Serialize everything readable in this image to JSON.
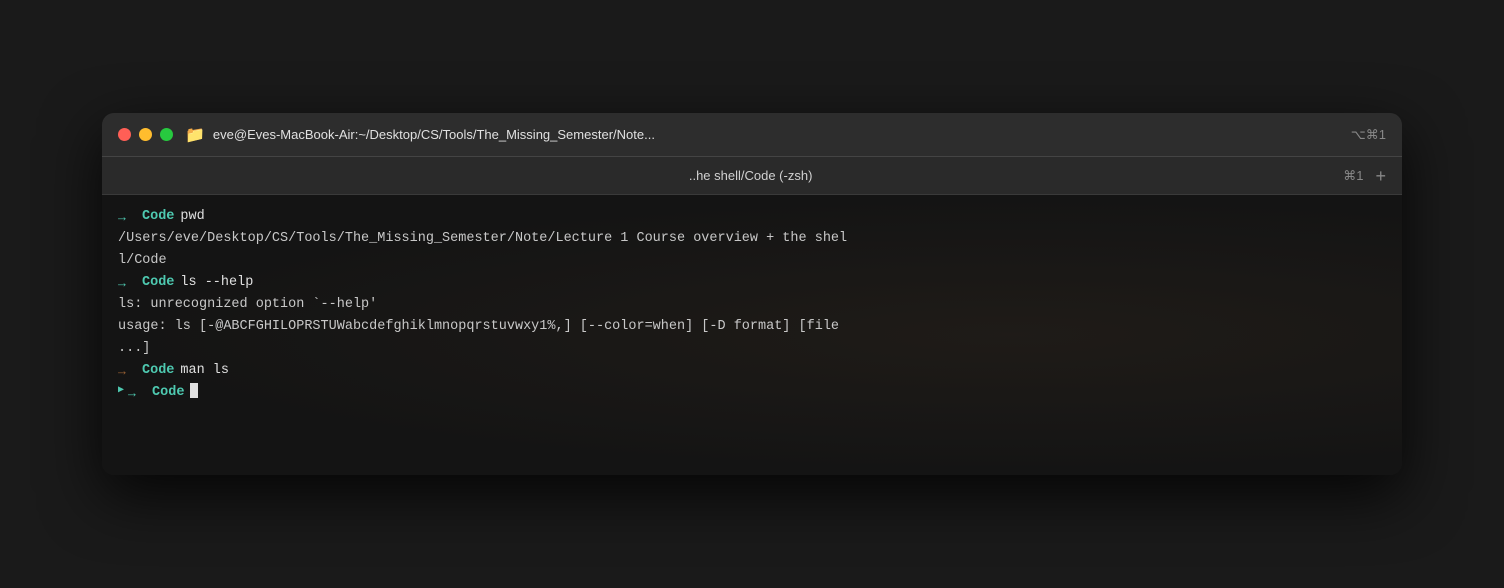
{
  "window": {
    "title": "eve@Eves-MacBook-Air:~/Desktop/CS/Tools/The_Missing_Semester/Note...",
    "shortcut": "⌥⌘1",
    "tab_title": "..he shell/Code (-zsh)",
    "tab_shortcut": "⌘1",
    "tab_plus": "+"
  },
  "terminal": {
    "lines": [
      {
        "type": "command",
        "arrow": "→",
        "label": "Code",
        "cmd": "pwd"
      },
      {
        "type": "output",
        "text": "/Users/eve/Desktop/CS/Tools/The_Missing_Semester/Note/Lecture 1 Course overview + the shel"
      },
      {
        "type": "output",
        "text": "l/Code"
      },
      {
        "type": "command",
        "arrow": "→",
        "label": "Code",
        "cmd": "ls --help"
      },
      {
        "type": "output",
        "text": "ls: unrecognized option `--help'"
      },
      {
        "type": "output",
        "text": "usage: ls [-@ABCFGHILOPRSTUWabcdefghiklmnopqrstuvwxy1%,] [--color=when] [-D format] [file"
      },
      {
        "type": "output",
        "text": "...]"
      },
      {
        "type": "command",
        "arrow": "→",
        "label": "Code",
        "cmd": "man ls",
        "dim": true
      },
      {
        "type": "command_active",
        "arrow": "→",
        "label": "Code",
        "cmd": "",
        "has_cursor": true
      }
    ]
  }
}
